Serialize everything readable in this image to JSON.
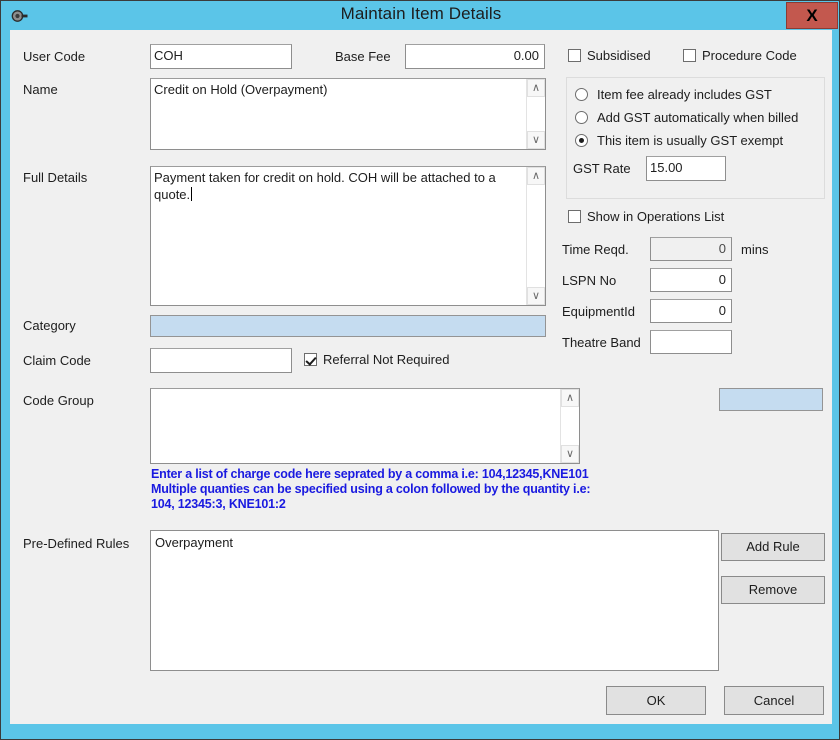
{
  "window": {
    "title": "Maintain Item Details",
    "icon": "spanner-icon",
    "close_label": "X",
    "titlebar_color": "#5bc5e8",
    "close_color": "#c3584e"
  },
  "form": {
    "user_code": {
      "label": "User Code",
      "value": "COH"
    },
    "base_fee": {
      "label": "Base Fee",
      "value": "0.00"
    },
    "name": {
      "label": "Name",
      "value": "Credit on Hold (Overpayment)"
    },
    "full_details": {
      "label": "Full Details",
      "value": "Payment taken for credit on hold. COH will be attached to a quote."
    },
    "category": {
      "label": "Category",
      "value": ""
    },
    "claim_code": {
      "label": "Claim Code",
      "value": ""
    },
    "referral_not_required": {
      "label": "Referral Not Required",
      "checked": true
    },
    "code_group": {
      "label": "Code Group",
      "value": ""
    },
    "code_group_combo": {
      "value": ""
    },
    "code_group_help": "Enter a list of charge code here seprated by a comma i.e: 104,12345,KNE101\nMultiple quanties can be specified using a colon followed by the quantity i.e:\n104, 12345:3, KNE101:2",
    "help_color": "#1a1ae0",
    "pre_defined_rules": {
      "label": "Pre-Defined Rules",
      "items": [
        "Overpayment"
      ]
    }
  },
  "right_panel": {
    "subsidised": {
      "label": "Subsidised",
      "checked": false
    },
    "procedure_code": {
      "label": "Procedure Code",
      "checked": false
    },
    "gst_options": [
      {
        "label": "Item fee already includes GST",
        "selected": false
      },
      {
        "label": "Add GST automatically when billed",
        "selected": false
      },
      {
        "label": "This item is usually GST exempt",
        "selected": true
      }
    ],
    "gst_rate": {
      "label": "GST Rate",
      "value": "15.00"
    },
    "show_in_operations_list": {
      "label": "Show in Operations List",
      "checked": false
    },
    "time_reqd": {
      "label": "Time Reqd.",
      "value": "0",
      "units": "mins",
      "disabled": true
    },
    "lspn_no": {
      "label": "LSPN No",
      "value": "0"
    },
    "equipment_id": {
      "label": "EquipmentId",
      "value": "0"
    },
    "theatre_band": {
      "label": "Theatre Band",
      "value": ""
    }
  },
  "buttons": {
    "add_rule": "Add Rule",
    "remove": "Remove",
    "ok": "OK",
    "cancel": "Cancel"
  },
  "scroll": {
    "up_glyph": "∧",
    "down_glyph": "∨"
  }
}
